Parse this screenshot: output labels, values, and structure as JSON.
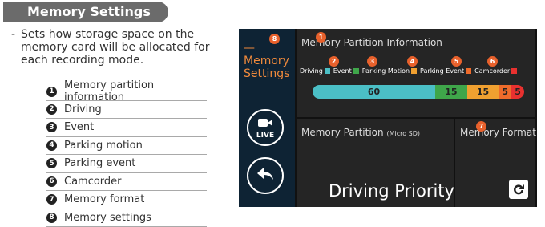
{
  "title": "Memory Settings",
  "description": "Sets how storage space on the memory card will be allocated for each recording mode.",
  "legend": [
    {
      "n": "1",
      "label": "Memory partition information"
    },
    {
      "n": "2",
      "label": "Driving"
    },
    {
      "n": "3",
      "label": "Event"
    },
    {
      "n": "4",
      "label": "Parking motion"
    },
    {
      "n": "5",
      "label": "Parking event"
    },
    {
      "n": "6",
      "label": "Camcorder"
    },
    {
      "n": "7",
      "label": "Memory format"
    },
    {
      "n": "8",
      "label": "Memory settings"
    }
  ],
  "screen": {
    "side_title_top": "Memory",
    "side_title_bottom": "Settings",
    "live_label": "LIVE",
    "partition_info_title": "Memory Partition Information",
    "keys": {
      "driving": "Driving",
      "event": "Event",
      "parking_motion": "Parking Motion",
      "parking_event": "Parking Event",
      "camcorder": "Camcorder"
    },
    "bar": {
      "driving": "60",
      "event": "15",
      "parking_motion": "15",
      "parking_event": "5",
      "camcorder": "5"
    },
    "partition_title": "Memory Partition",
    "partition_sub": "(Micro SD)",
    "partition_value": "Driving Priority",
    "format_title": "Memory Format"
  },
  "badges": {
    "b1": "1",
    "b2": "2",
    "b3": "3",
    "b4": "4",
    "b5": "5",
    "b6": "6",
    "b7": "7",
    "b8": "8"
  },
  "colors": {
    "driving": "#4bbfc6",
    "event": "#3fa64a",
    "parking_motion": "#f0a030",
    "parking_event": "#ee6b2b",
    "camcorder": "#e8312f",
    "accent": "#e8612c"
  },
  "icons": {
    "live": "camera-icon",
    "back": "back-arrow-icon",
    "format": "refresh-icon"
  }
}
